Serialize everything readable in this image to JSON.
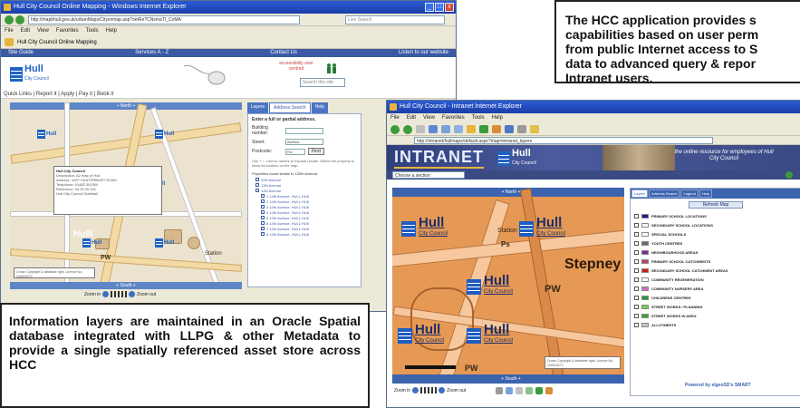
{
  "win1": {
    "title": "Hull City Council Online Mapping - Windows Internet Explorer",
    "address": "http://mapbhull.gov.uk/urbanMaps/Cityexmap.asp?setRe?CNsmaTI_CoMA",
    "search_placeholder": "Live Search",
    "menu": [
      "File",
      "Edit",
      "View",
      "Favorites",
      "Tools",
      "Help"
    ],
    "tab_label": "Hull City Council Online Mapping",
    "topnav": [
      "Site Guide",
      "Services A - Z",
      "Contact Us",
      "Listen to our website"
    ],
    "brand": "Hull",
    "brand_sub": "City Council",
    "badge": "accessibility user centred",
    "search_site": "Search this site",
    "quicklinks": "Quick Links  |  Report it  |  Apply  |  Pay it  |  Book it",
    "map_header": "+ North +",
    "map_footer": "+ South +",
    "popup_lines": [
      "Hull City Council",
      "Description: A2 map of Hull",
      "Address: 1007 CANTERBURY ROAD",
      "Telephone: 01482 300300",
      "Reference: 44 20 00 001",
      "Hull City Council Guildhall"
    ],
    "pin_label": "Hull",
    "pin_sub": "City Council",
    "map_labels": {
      "pw": "PW",
      "hulli": "Hulli",
      "station": "Station"
    },
    "copyright": "Crown Copyright & database right. Licence No. 100023372",
    "zoom_in": "Zoom in",
    "zoom_out": "Zoom out",
    "tabs": [
      "Layers",
      "Address Search",
      "Help"
    ],
    "form": {
      "heading": "Enter a full or partial address.",
      "fields": [
        {
          "label": "Building number:",
          "value": ""
        },
        {
          "label": "Street:",
          "value": "Avenue"
        },
        {
          "label": "Postcode:",
          "value": "HU"
        }
      ],
      "find": "Find",
      "hint": "Use + / - next to names to expand results. Select the property to show its location on the map.",
      "result_header": "Properties found similar to 120th Avenue:",
      "tree": [
        "12th Avenue",
        "13th Avenue",
        "12th Avenue",
        "1 12th Avenue, HULL HU6",
        "2 12th Avenue, HULL HU6",
        "3 12th Avenue, HULL HU6",
        "4 12th Avenue, HULL HU6",
        "5 12th Avenue, HULL HU6",
        "6 12th Avenue, HULL HU6",
        "7 12th Avenue, HULL HU6",
        "8 12th Avenue, HULL HU6"
      ]
    }
  },
  "callouts": {
    "top": "The HCC application provides s\ncapabilities based on user perm\nfrom public Internet access to S\ndata to advanced query & repor\nIntranet users.",
    "bottom": "Information layers are maintained in an Oracle Spatial database integrated with LLPG & other Metadata to provide a single spatially referenced asset store across HCC"
  },
  "win2": {
    "title": "Hull City Council - Intranet Internet Explorer",
    "menu": [
      "File",
      "Edit",
      "View",
      "Favorites",
      "Tools",
      "Help"
    ],
    "address": "http://intranet/hullmaps/default.aspx?map=intranet_layers",
    "intranet_word": "INTRANET",
    "brand": "Hull",
    "brand_sub": "City Council",
    "tagline": "the online resource for employees of Hull City Council",
    "select_value": "Choose a section",
    "map_header": "+ North +",
    "map_footer": "+ South +",
    "pins": [
      {
        "word": "Hull",
        "sub": "City Council"
      },
      {
        "word": "Hull",
        "sub": "City Council"
      },
      {
        "word": "Hull",
        "sub": "City Council"
      },
      {
        "word": "Hull",
        "sub": "City Council"
      },
      {
        "word": "Hull",
        "sub": "City Council"
      }
    ],
    "map_labels": {
      "stepney": "Stepney",
      "pw1": "PW",
      "pw2": "PW",
      "station": "Station",
      "ps": "Ps"
    },
    "copyright": "Crown Copyright & database right. Licence No. 100023372",
    "layer_tabs": [
      "Layers",
      "Address Search",
      "Legend",
      "Help"
    ],
    "refresh": "Refresh Map",
    "layers": [
      {
        "name": "PRIMARY SCHOOL LOCATIONS",
        "color": "#1b1b8a"
      },
      {
        "name": "SECONDARY SCHOOL LOCATIONS",
        "color": "#ffffff"
      },
      {
        "name": "SPECIAL SCHOOLS",
        "color": "#ffffff"
      },
      {
        "name": "YOUTH CENTRES",
        "color": "#6b6b6b"
      },
      {
        "name": "NEIGHBOURHOOD AREAS",
        "color": "#7c2a9c"
      },
      {
        "name": "PRIMARY SCHOOL CATCHMENTS",
        "color": "#c43b7a"
      },
      {
        "name": "SECONDARY SCHOOL CATCHMENT AREAS",
        "color": "#d21c1c"
      },
      {
        "name": "COMMUNITY REGENERATION",
        "color": "#ffffff"
      },
      {
        "name": "COMMUNITY NURSERY AREA",
        "color": "#d06ad0"
      },
      {
        "name": "CHILDRENS CENTRES",
        "color": "#2a9a3a"
      },
      {
        "name": "STREET WORKS / PLANNING",
        "color": "#7acc4a"
      },
      {
        "name": "STREET WORKS IN AREA",
        "color": "#38a538"
      },
      {
        "name": "ALLOTMENTS",
        "color": "#c7c7c7"
      }
    ],
    "powered": "Powered by elgeoSD's SMART",
    "zoom_in": "Zoom in",
    "zoom_out": "Zoom out"
  },
  "colors": {
    "accent": "#1e63c4",
    "ie_title": "#2c5bd2",
    "map_orange": "#e59954"
  }
}
